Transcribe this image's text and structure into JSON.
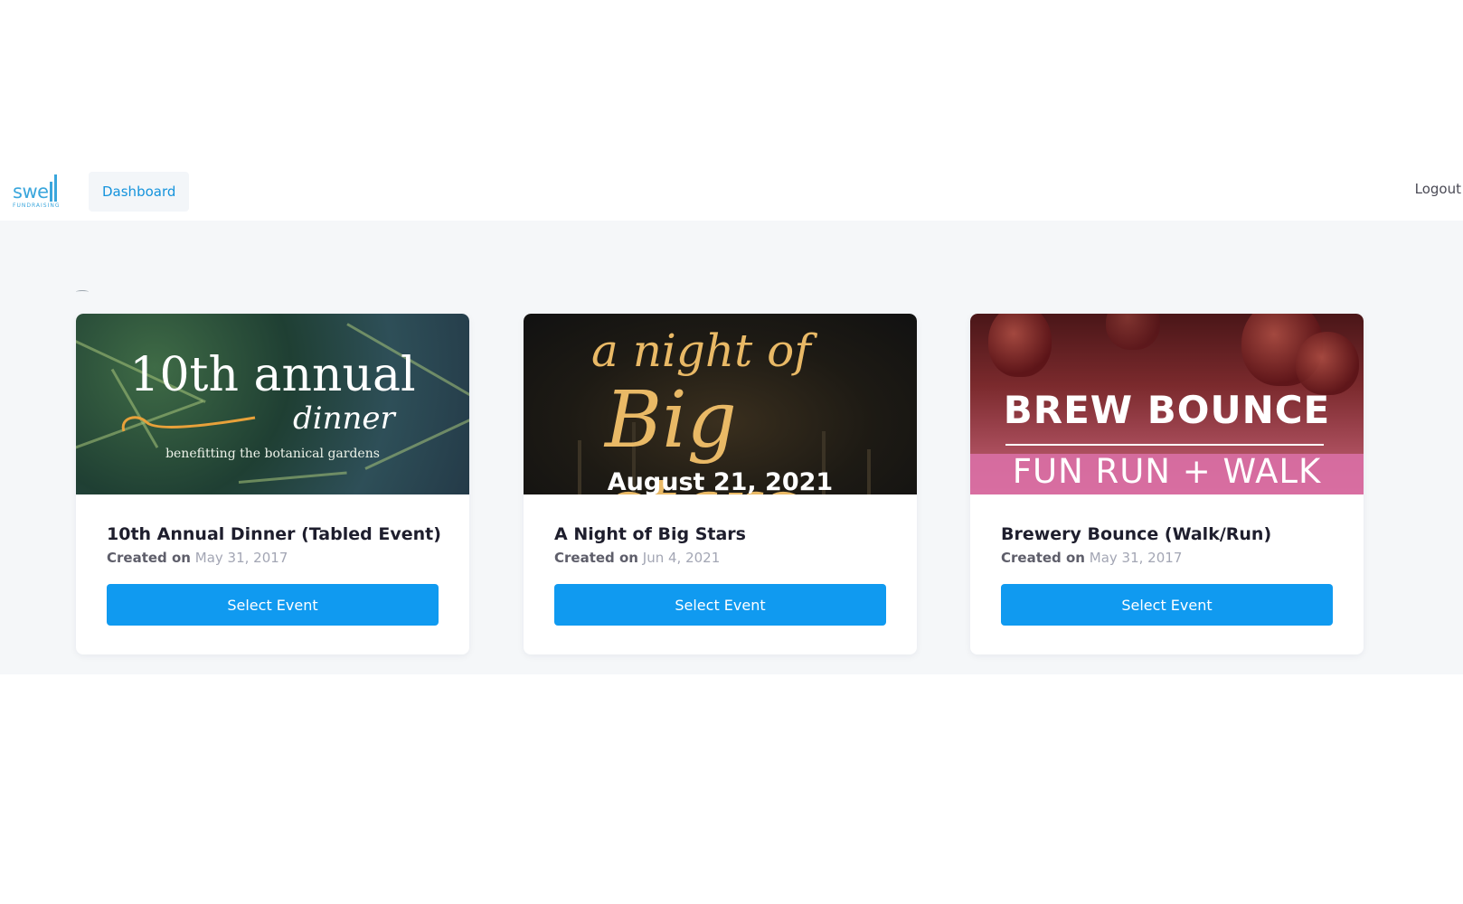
{
  "brand": {
    "logo_word": "swe",
    "logo_sub": "FUNDRAISING",
    "color": "#3aa6dc"
  },
  "nav": {
    "dashboard_label": "Dashboard",
    "logout_label": "Logout"
  },
  "events": [
    {
      "title": "10th Annual Dinner (Tabled Event)",
      "created_label": "Created on",
      "created_date": "May 31, 2017",
      "button_label": "Select Event",
      "image": {
        "line1": "10th annual",
        "line2": "dinner",
        "line3": "benefitting the botanical gardens"
      }
    },
    {
      "title": "A Night of Big Stars",
      "created_label": "Created on",
      "created_date": "Jun 4, 2021",
      "button_label": "Select Event",
      "image": {
        "line1": "a night of",
        "line2": "Big stars",
        "line3": "August 21, 2021"
      }
    },
    {
      "title": "Brewery Bounce (Walk/Run)",
      "created_label": "Created on",
      "created_date": "May 31, 2017",
      "button_label": "Select Event",
      "image": {
        "line1": "BREW BOUNCE",
        "line2": "FUN RUN + WALK"
      }
    }
  ],
  "colors": {
    "primary_button": "#109af0",
    "page_background": "#f5f7f9"
  }
}
